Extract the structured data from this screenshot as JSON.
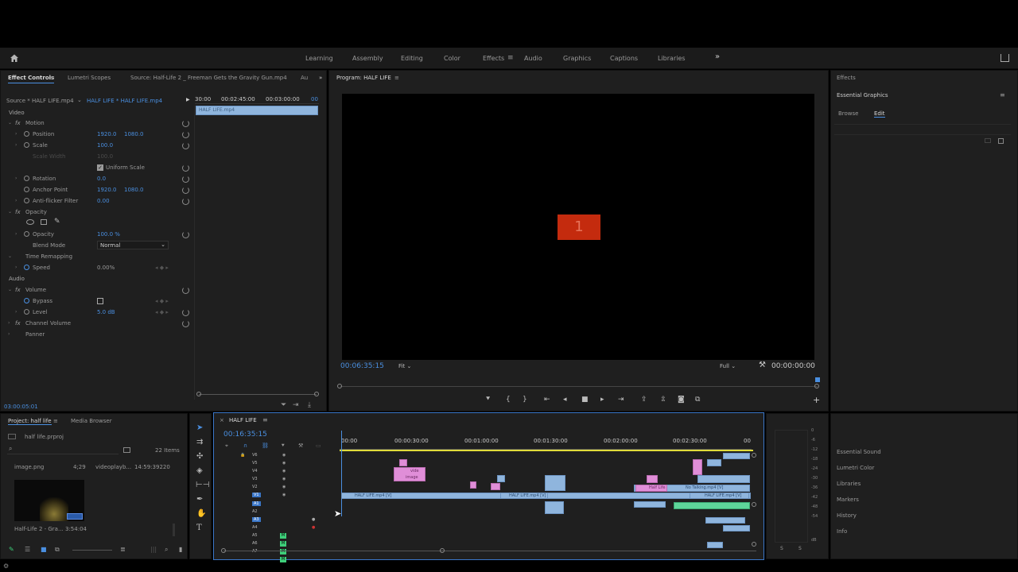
{
  "header": {
    "home_icon": "home-icon",
    "share_icon": "share-icon",
    "more": "»"
  },
  "workspaces": [
    "Learning",
    "Assembly",
    "Editing",
    "Color",
    "Effects",
    "Audio",
    "Graphics",
    "Captions",
    "Libraries"
  ],
  "active_workspace": "Effects",
  "effect_controls": {
    "tabs": [
      "Effect Controls",
      "Lumetri Scopes",
      "Source: Half-Life 2 _ Freeman Gets the Gravity Gun.mp4",
      "Au"
    ],
    "source_label": "Source * HALF LIFE.mp4",
    "sequence_label": "HALF LIFE * HALF LIFE.mp4",
    "time_ruler": [
      "30:00",
      "00:02:45:00",
      "00:03:00:00",
      "00"
    ],
    "clip_name": "HALF LIFE.mp4",
    "section_video": "Video",
    "motion": "Motion",
    "position_label": "Position",
    "position_x": "1920.0",
    "position_y": "1080.0",
    "scale_label": "Scale",
    "scale_value": "100.0",
    "scale_width_label": "Scale Width",
    "scale_width_value": "100.0",
    "uniform_scale": "Uniform Scale",
    "rotation_label": "Rotation",
    "rotation_value": "0.0",
    "anchor_label": "Anchor Point",
    "anchor_x": "1920.0",
    "anchor_y": "1080.0",
    "antiflicker_label": "Anti-flicker Filter",
    "antiflicker_value": "0.00",
    "opacity_section": "Opacity",
    "opacity_label": "Opacity",
    "opacity_value": "100.0 %",
    "blend_label": "Blend Mode",
    "blend_value": "Normal",
    "time_remap": "Time Remapping",
    "speed_label": "Speed",
    "speed_value": "0.00%",
    "section_audio": "Audio",
    "volume": "Volume",
    "bypass_label": "Bypass",
    "level_label": "Level",
    "level_value": "5.0 dB",
    "channel_volume": "Channel Volume",
    "panner": "Panner",
    "timecode": "03:00:05:01"
  },
  "program": {
    "title": "Program: HALF LIFE",
    "frame_text": "1",
    "frame_color": "#c42b0e",
    "timecode_left": "00:06:35:15",
    "fit": "Fit",
    "quality": "Full",
    "timecode_right": "00:00:00:00"
  },
  "effects_panel": {
    "title": "Effects",
    "essential_graphics": "Essential Graphics",
    "tab_browse": "Browse",
    "tab_edit": "Edit",
    "side_items": [
      "Essential Sound",
      "Lumetri Color",
      "Libraries",
      "Markers",
      "History",
      "Info"
    ]
  },
  "project": {
    "tabs": [
      "Project: half life",
      "Media Browser"
    ],
    "file": "half life.prproj",
    "item_count": "22 Items",
    "row_name": "image.png",
    "row_val": "4;29",
    "row_col": "videoplayb...",
    "row_time": "14:59:39220",
    "thumb_name": "Half-Life 2 - Gra...",
    "thumb_dur": "3:54:04"
  },
  "timeline": {
    "title": "HALF LIFE",
    "timecode": "00:16:35:15",
    "ruler": [
      "00:00",
      "00:00:30:00",
      "00:01:00:00",
      "00:01:30:00",
      "00:02:00:00",
      "00:02:30:00",
      "00"
    ],
    "video_tracks": [
      "V6",
      "V5",
      "V4",
      "V3",
      "V2",
      "V1"
    ],
    "audio_tracks": [
      "A1",
      "A2",
      "A3",
      "A4",
      "A5",
      "A6",
      "A7"
    ],
    "clip_labels": [
      "HALF LIFE.mp4 [V]",
      "HALF LIFE.mp4 [V]",
      "HALF LIFE.mp4 [V]",
      "No Talking.mp4 [V]",
      "Half Life",
      "image",
      "vide"
    ]
  },
  "meter": {
    "ticks": [
      "0",
      "-6",
      "-12",
      "-18",
      "-24",
      "-30",
      "-36",
      "-42",
      "-48",
      "-54",
      "dB"
    ],
    "solo": [
      "S",
      "S"
    ]
  }
}
